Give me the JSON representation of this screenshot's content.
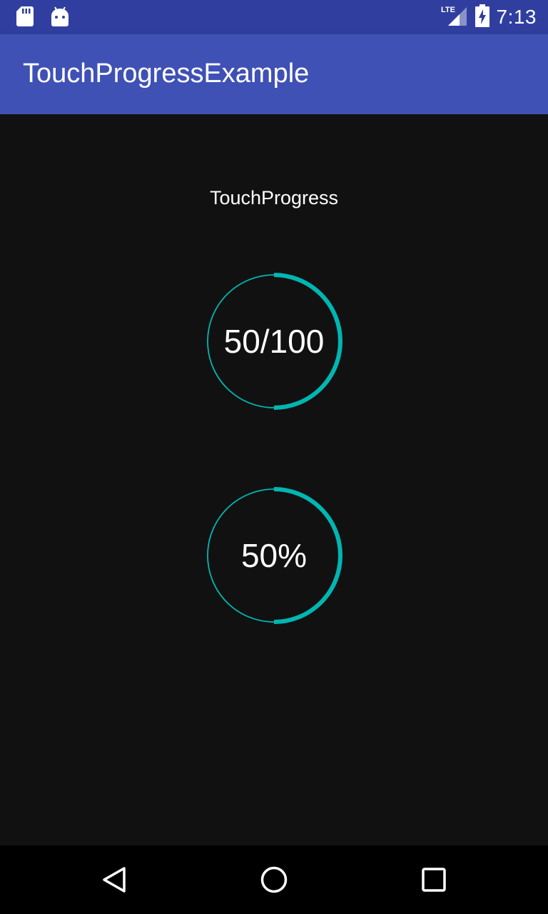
{
  "status_bar": {
    "time": "7:13",
    "network_label": "LTE",
    "icons": [
      "sd-card-icon",
      "android-icon",
      "lte-signal-icon",
      "battery-charging-icon"
    ]
  },
  "app_bar": {
    "title": "TouchProgressExample"
  },
  "main": {
    "label": "TouchProgress",
    "progress_items": [
      {
        "text": "50/100",
        "progress": 0.5
      },
      {
        "text": "50%",
        "progress": 0.5
      }
    ]
  },
  "colors": {
    "accent": "#00b6b2",
    "status_bar": "#303f9f",
    "app_bar": "#3f51b5",
    "background": "#111111"
  },
  "nav_bar": {
    "icons": [
      "back-icon",
      "home-icon",
      "recents-icon"
    ]
  }
}
